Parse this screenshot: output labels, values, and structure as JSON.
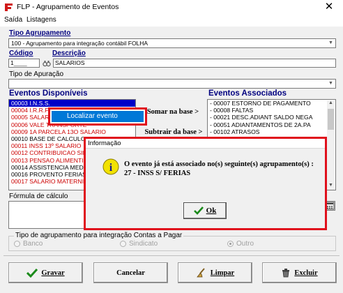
{
  "window": {
    "title": "FLP - Agrupamento de Eventos",
    "close_glyph": "✕"
  },
  "menu": [
    "Saída",
    "Listagens"
  ],
  "tipo_agrupamento": {
    "label": "Tipo Agrupamento",
    "value": "100 - Agrupamento para integração contábil FOLHA"
  },
  "codigo": {
    "label": "Código",
    "value": "1"
  },
  "descricao": {
    "label": "Descrição",
    "value": "SALARIOS"
  },
  "tipo_apuracao": {
    "label": "Tipo de Apuração",
    "value": ""
  },
  "eventos_disponiveis": {
    "label": "Eventos Disponíveis",
    "items": [
      "00003 I.N.S.S.",
      "00004 I.R.R.F.",
      "00005 SALARIO",
      "00006 VALE TRANSPORTE",
      "00009 1A PARCELA 13O SALARIO",
      "00010 BASE DE CALCULO DE",
      "00011 INSS 13º SALARIO",
      "00012 CONTRIBUICAO SIN",
      "00013 PENSAO ALIMENTICIA",
      "00014 ASSISTENCIA MEDICA",
      "00016 PROVENTO FERIAS",
      "00017 SALARIO MATERNIDADE"
    ]
  },
  "context_menu": {
    "item": "Localizar evento"
  },
  "buttons_mid": {
    "somar": "Somar  na base >",
    "subtrair": "Subtrair da base >"
  },
  "eventos_associados": {
    "label": "Eventos Associados",
    "items": [
      "- 00007 ESTORNO DE PAGAMENTO",
      "- 00008 FALTAS",
      "- 00021 DESC.ADIANT SALDO NEGA",
      "- 00051 ADIANTAMENTOS DE 2A.PA",
      "- 00102 ATRASOS"
    ]
  },
  "formula": {
    "label": "Fórmula de cálculo"
  },
  "contas_pagar": {
    "label": "Tipo de agrupamento para integração Contas a Pagar",
    "options": [
      "Banco",
      "Sindicato",
      "Outro"
    ]
  },
  "dialog": {
    "title": "Informação",
    "message": "O evento já está associado no(s) seguinte(s) agrupamento(s) :",
    "detail": "27 - INSS S/ FERIAS",
    "ok": "Ok",
    "ok_hotkey": "O",
    "info_icon": "info-icon"
  },
  "bottom_buttons": {
    "gravar": "Gravar",
    "cancelar": "Cancelar",
    "limpar": "Limpar",
    "excluir": "Excluir"
  },
  "colors": {
    "highlight_red": "#e0101c",
    "list_red": "#cc0000",
    "heading_blue": "#000080",
    "selection_blue": "#0000c8",
    "menu_highlight": "#0078d7"
  }
}
